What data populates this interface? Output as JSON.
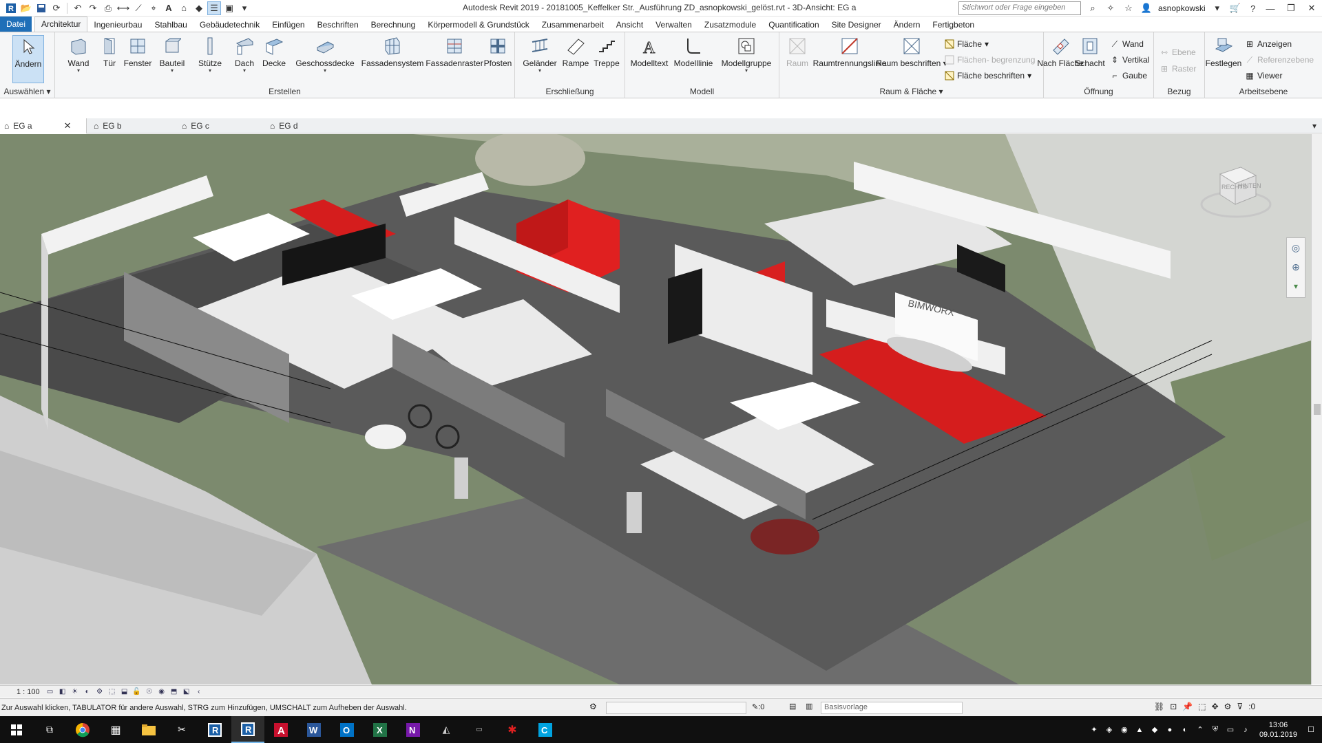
{
  "app": {
    "title": "Autodesk Revit 2019 - 20181005_Keffelker Str._Ausführung ZD_asnopkowski_gelöst.rvt - 3D-Ansicht: EG a"
  },
  "search": {
    "placeholder": "Stichwort oder Frage eingeben"
  },
  "user": {
    "name": "asnopkowski"
  },
  "menu": {
    "file": "Datei",
    "tabs": [
      "Architektur",
      "Ingenieurbau",
      "Stahlbau",
      "Gebäudetechnik",
      "Einfügen",
      "Beschriften",
      "Berechnung",
      "Körpermodell & Grundstück",
      "Zusammenarbeit",
      "Ansicht",
      "Verwalten",
      "Zusatzmodule",
      "Quantification",
      "Site Designer",
      "Ändern",
      "Fertigbeton"
    ],
    "active": "Architektur"
  },
  "ribbon": {
    "select": {
      "modify": "Ändern",
      "label": "Auswählen"
    },
    "create": {
      "label": "Erstellen",
      "wall": "Wand",
      "door": "Tür",
      "window": "Fenster",
      "component": "Bauteil",
      "column": "Stütze",
      "roof": "Dach",
      "ceiling": "Decke",
      "floor": "Geschossdecke",
      "curtain_system": "Fassadensystem",
      "curtain_grid": "Fassadenraster",
      "mullion": "Pfosten"
    },
    "circulation": {
      "label": "Erschließung",
      "railing": "Geländer",
      "ramp": "Rampe",
      "stair": "Treppe"
    },
    "model": {
      "label": "Modell",
      "text": "Modelltext",
      "line": "Modelllinie",
      "group": "Modellgruppe"
    },
    "room": {
      "label": "Raum & Fläche",
      "room": "Raum",
      "separator": "Raumtrennungslinie",
      "tag_room": "Raum beschriften",
      "area": "Fläche",
      "area_boundary": "Flächen- begrenzung",
      "tag_area": "Fläche beschriften"
    },
    "opening": {
      "label": "Öffnung",
      "by_face": "Nach Fläche",
      "shaft": "Schacht",
      "wall": "Wand",
      "vertical": "Vertikal",
      "dormer": "Gaube"
    },
    "datum": {
      "label": "Bezug",
      "level": "Ebene",
      "grid": "Raster"
    },
    "workplane": {
      "label": "Arbeitsebene",
      "set": "Festlegen",
      "show": "Anzeigen",
      "ref_plane": "Referenzebene",
      "viewer": "Viewer"
    }
  },
  "views": {
    "tabs": [
      "EG a",
      "EG b",
      "EG c",
      "EG d"
    ]
  },
  "viewport": {
    "brand": "BIMWORX",
    "viewcube": {
      "right": "RECHTS",
      "back": "HINTEN"
    }
  },
  "viewbar": {
    "scale": "1 : 100"
  },
  "status": {
    "message": "Zur Auswahl klicken, TABULATOR für andere Auswahl, STRG zum Hinzufügen, UMSCHALT zum Aufheben der Auswahl.",
    "worksets": ":0",
    "template": "Basisvorlage",
    "filter": ":0"
  },
  "taskbar": {
    "time": "13:06",
    "date": "09.01.2019"
  }
}
